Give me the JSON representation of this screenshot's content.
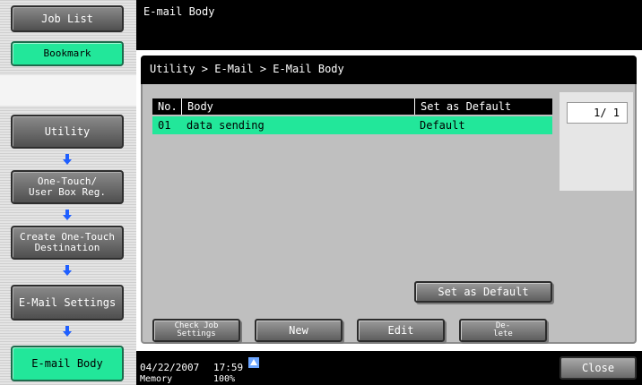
{
  "sidebar": {
    "job_list": "Job List",
    "bookmark": "Bookmark",
    "utility": "Utility",
    "one_touch": "One-Touch/\nUser Box Reg.",
    "create_one_touch": "Create One-Touch\nDestination",
    "email_settings": "E-Mail Settings",
    "email_body": "E-mail Body"
  },
  "header": {
    "title": "E-mail Body"
  },
  "breadcrumb": "Utility > E-Mail > E-Mail Body",
  "table": {
    "columns": [
      "No.",
      "Body",
      "Set as Default"
    ],
    "rows": [
      {
        "no": "01",
        "body": "data sending",
        "default": "Default"
      }
    ]
  },
  "pagination": {
    "text": "1/ 1"
  },
  "buttons": {
    "set_default": "Set as Default",
    "check_job": "Check Job\nSettings",
    "new": "New",
    "edit": "Edit",
    "delete": "De-\nlete",
    "close": "Close"
  },
  "status": {
    "date": "04/22/2007",
    "time": "17:59",
    "memory_label": "Memory",
    "memory_value": "100%"
  },
  "colors": {
    "accent_green": "#22e79a",
    "header_black": "#000000"
  }
}
